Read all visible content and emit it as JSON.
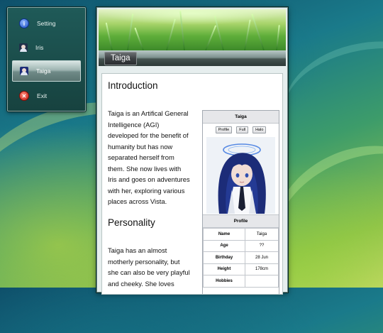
{
  "sidebar": {
    "items": [
      {
        "label": "Setting",
        "icon": "info-icon"
      },
      {
        "label": "Iris",
        "icon": "iris-avatar-icon"
      },
      {
        "label": "Taiga",
        "icon": "taiga-avatar-icon",
        "active": true
      },
      {
        "label": "Exit",
        "icon": "exit-icon"
      }
    ]
  },
  "window": {
    "title": "Taiga"
  },
  "article": {
    "sections": [
      {
        "heading": "Introduction",
        "lines": [
          "Taiga is an Artifical General",
          "Intelligence (AGI)",
          "developed for the benefit of",
          "humanity but has now",
          "separated herself from",
          "them. She now lives with",
          "Iris and goes on adventures",
          "with her, exploring various",
          "places across Vista."
        ]
      },
      {
        "heading": "Personality",
        "lines": [
          "Taiga has an almost",
          "motherly personality, but",
          "she can also be very playful",
          "and cheeky. She loves"
        ]
      }
    ]
  },
  "infobox": {
    "title": "Taiga",
    "tabs": [
      "Profile",
      "Full",
      "Halo"
    ],
    "section": "Profile",
    "rows": [
      {
        "key": "Name",
        "value": "Taiga"
      },
      {
        "key": "Age",
        "value": "??"
      },
      {
        "key": "Birthday",
        "value": "28 Jun"
      },
      {
        "key": "Height",
        "value": "178cm"
      },
      {
        "key": "Hobbies",
        "value": ""
      }
    ]
  },
  "colors": {
    "accent_halo": "#3c78e0",
    "menu_bg": "#1f5a58",
    "hair": "#1c2c78"
  }
}
